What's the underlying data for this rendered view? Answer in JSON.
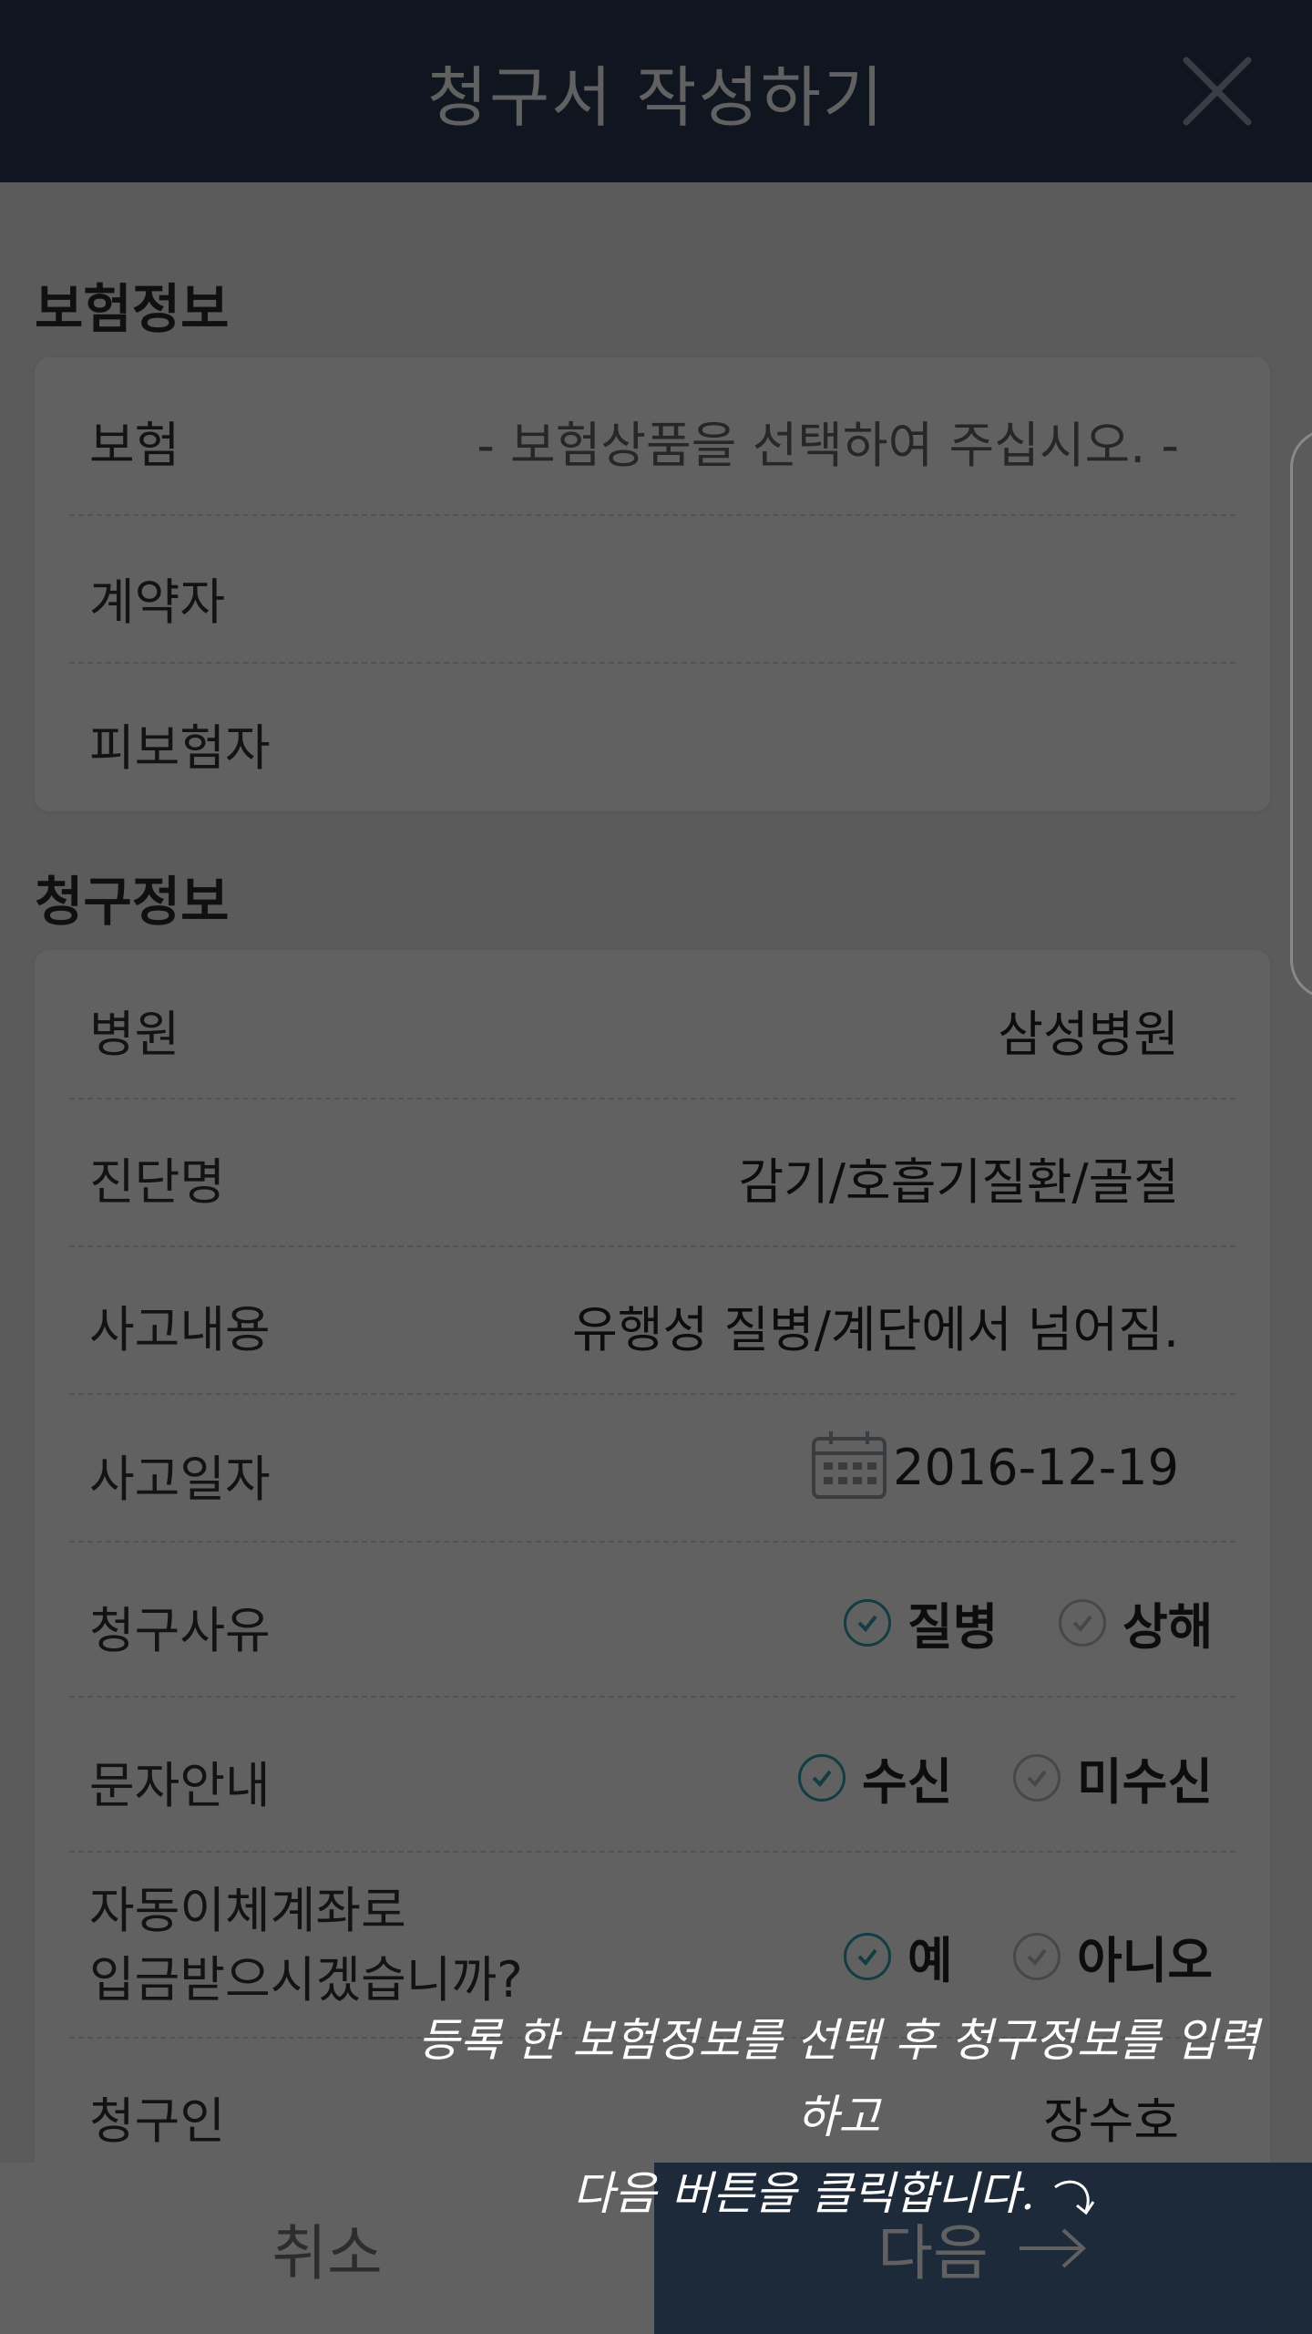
{
  "header": {
    "title": "청구서 작성하기"
  },
  "insurance_section": {
    "title": "보험정보",
    "rows": [
      {
        "label": "보험",
        "value": "- 보험상품을 선택하여 주십시오. -"
      },
      {
        "label": "계약자",
        "value": ""
      },
      {
        "label": "피보험자",
        "value": ""
      }
    ]
  },
  "claim_section": {
    "title": "청구정보",
    "hospital": {
      "label": "병원",
      "value": "삼성병원"
    },
    "diagnosis": {
      "label": "진단명",
      "value": "감기/호흡기질환/골절"
    },
    "accident": {
      "label": "사고내용",
      "value": "유행성 질병/계단에서 넘어짐."
    },
    "accident_date": {
      "label": "사고일자",
      "value": "2016-12-19"
    },
    "reason": {
      "label": "청구사유",
      "options": [
        "질병",
        "상해"
      ],
      "selected": "질병"
    },
    "sms": {
      "label": "문자안내",
      "options": [
        "수신",
        "미수신"
      ],
      "selected": "수신"
    },
    "auto_transfer": {
      "label_line1": "자동이체계좌로",
      "label_line2": "입금받으시겠습니까?",
      "options": [
        "예",
        "아니오"
      ],
      "selected": "예"
    },
    "claimant": {
      "label": "청구인",
      "value": "장수호"
    }
  },
  "footer": {
    "cancel_label": "취소",
    "next_label": "다음"
  },
  "tutorial_hint": {
    "line1": "등록 한 보험정보를 선택 후 청구정보를 입력하고",
    "line2": "다음 버튼을 클릭합니다."
  },
  "colors": {
    "header_bg": "#2c3b54",
    "accent": "#2aa4ad",
    "next_button": "#4d6e9a"
  }
}
